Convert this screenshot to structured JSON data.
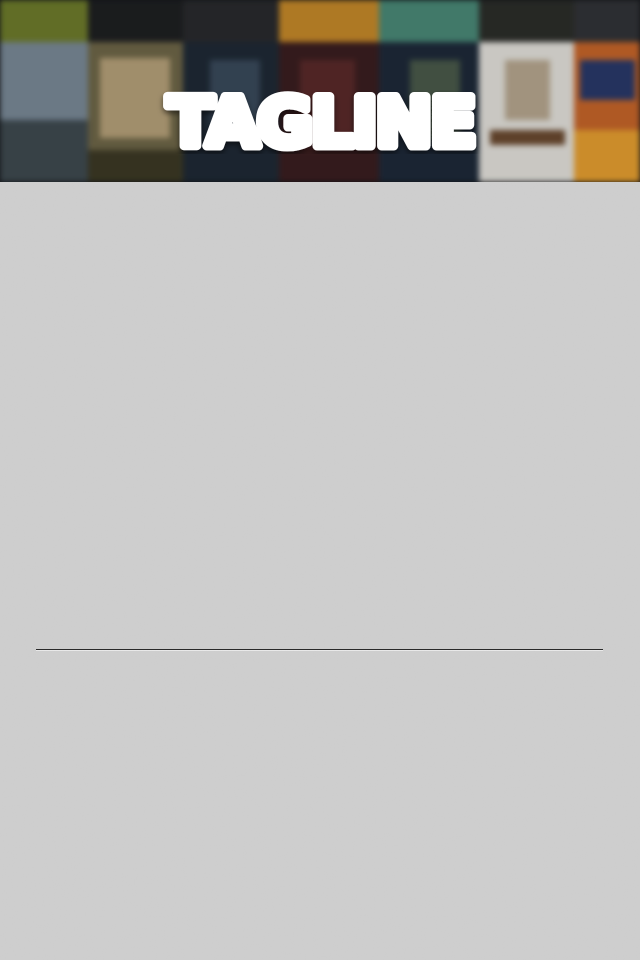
{
  "header": {
    "logo_text": "TAGLINE",
    "logo_color": "#ffffff",
    "background_posters": [
      {
        "name": "poster-green-animated",
        "color": "#6f7d2c"
      },
      {
        "name": "poster-dark-figure",
        "color": "#1e2022"
      },
      {
        "name": "poster-dark-room",
        "color": "#2a2b2e"
      },
      {
        "name": "poster-dark-street",
        "color": "#252527"
      },
      {
        "name": "poster-yellow-orange",
        "color": "#c78a2a"
      },
      {
        "name": "poster-teal-bus",
        "color": "#4a8a78"
      },
      {
        "name": "poster-dark-crowd",
        "color": "#2c2e2a"
      },
      {
        "name": "poster-dark-grey",
        "color": "#323438"
      },
      {
        "name": "poster-blue-war",
        "color": "#7a8a98"
      },
      {
        "name": "poster-couple",
        "color": "#6f6748"
      },
      {
        "name": "poster-dark-man",
        "color": "#1f2a36"
      },
      {
        "name": "poster-red-dark",
        "color": "#3b1e20"
      },
      {
        "name": "poster-dark-blue",
        "color": "#1e2a3a"
      },
      {
        "name": "poster-white-bench",
        "color": "#e5e3dd"
      },
      {
        "name": "poster-orange-delorean",
        "color": "#c8662a"
      }
    ]
  },
  "content": {
    "background_color": "#cfcfcf",
    "divider_color": "#2a2a2a"
  }
}
